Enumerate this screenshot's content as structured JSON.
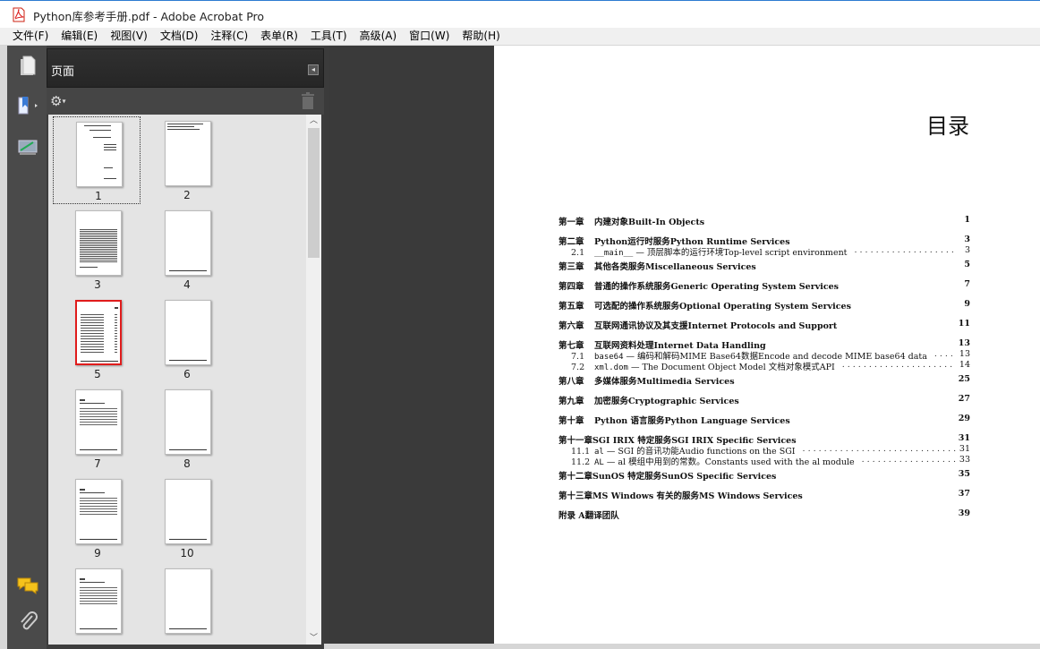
{
  "window": {
    "title": "Python库参考手册.pdf - Adobe Acrobat Pro"
  },
  "menu": [
    "文件(F)",
    "编辑(E)",
    "视图(V)",
    "文档(D)",
    "注释(C)",
    "表单(R)",
    "工具(T)",
    "高级(A)",
    "窗口(W)",
    "帮助(H)"
  ],
  "nav": {
    "icons": [
      "pages-icon",
      "bookmarks-icon",
      "signatures-icon",
      "comments-icon",
      "attachments-icon"
    ]
  },
  "panel": {
    "title": "页面",
    "collapse": "◂"
  },
  "thumbnails": [
    {
      "num": "1",
      "selected": true,
      "active": false
    },
    {
      "num": "2",
      "selected": false,
      "active": false
    },
    {
      "num": "3",
      "selected": false,
      "active": false
    },
    {
      "num": "4",
      "selected": false,
      "active": false
    },
    {
      "num": "5",
      "selected": false,
      "active": true
    },
    {
      "num": "6",
      "selected": false,
      "active": false
    },
    {
      "num": "7",
      "selected": false,
      "active": false
    },
    {
      "num": "8",
      "selected": false,
      "active": false
    },
    {
      "num": "9",
      "selected": false,
      "active": false
    },
    {
      "num": "10",
      "selected": false,
      "active": false
    },
    {
      "num": "",
      "selected": false,
      "active": false
    },
    {
      "num": "",
      "selected": false,
      "active": false
    }
  ],
  "document": {
    "heading": "目录",
    "toc": [
      {
        "type": "chap",
        "chap": "第一章",
        "title": "内建对象Built-In Objects",
        "page": "1"
      },
      {
        "type": "chap",
        "chap": "第二章",
        "title": "Python运行时服务Python Runtime Services",
        "page": "3"
      },
      {
        "type": "sub",
        "n": "2.1",
        "pre_mono": "__main__",
        "title": " — 顶层脚本的运行环境Top-level script environment",
        "page": "3"
      },
      {
        "type": "chap",
        "chap": "第三章",
        "title": "其他各类服务Miscellaneous Services",
        "page": "5"
      },
      {
        "type": "chap",
        "chap": "第四章",
        "title": "普通的操作系统服务Generic Operating System Services",
        "page": "7"
      },
      {
        "type": "chap",
        "chap": "第五章",
        "title": "可选配的操作系统服务Optional Operating System Services",
        "page": "9"
      },
      {
        "type": "chap",
        "chap": "第六章",
        "title": "互联网通讯协议及其支援Internet Protocols and Support",
        "page": "11"
      },
      {
        "type": "chap",
        "chap": "第七章",
        "title": "互联网资料处理Internet Data Handling",
        "page": "13"
      },
      {
        "type": "sub",
        "n": "7.1",
        "pre_mono": "base64",
        "title": " — 编码和解码MIME Base64数据Encode and decode MIME base64 data",
        "page": "13"
      },
      {
        "type": "sub",
        "n": "7.2",
        "pre_mono": "xml.dom",
        "title": " — The Document Object Model 文档对象模式API",
        "page": "14"
      },
      {
        "type": "chap",
        "chap": "第八章",
        "title": "多媒体服务Multimedia Services",
        "page": "25"
      },
      {
        "type": "chap",
        "chap": "第九章",
        "title": "加密服务Cryptographic Services",
        "page": "27"
      },
      {
        "type": "chap",
        "chap": "第十章",
        "title": "Python 语言服务Python Language Services",
        "page": "29"
      },
      {
        "type": "chap",
        "chap": "第十一章",
        "title": "SGI IRIX 特定服务SGI IRIX Specific Services",
        "page": "31"
      },
      {
        "type": "sub",
        "n": "11.1",
        "pre_mono": "al",
        "title": " — SGI 的音讯功能Audio functions on the SGI",
        "page": "31"
      },
      {
        "type": "sub",
        "n": "11.2",
        "pre_mono": "AL",
        "title": " — al 模组中用到的常数。Constants used with the al module",
        "page": "33"
      },
      {
        "type": "chap",
        "chap": "第十二章",
        "title": "SunOS 特定服务SunOS Specific Services",
        "page": "35"
      },
      {
        "type": "chap",
        "chap": "第十三章",
        "title": "MS Windows 有关的服务MS Windows Services",
        "page": "37"
      },
      {
        "type": "chap",
        "chap": "附录 A",
        "title": "翻译团队",
        "page": "39"
      }
    ]
  },
  "colors": {
    "panel_bg": "#3d3d3d",
    "thumb_area": "#e4e4e4",
    "doc_bg": "#3a3a3a",
    "active_thumb_border": "#e01c1c"
  }
}
